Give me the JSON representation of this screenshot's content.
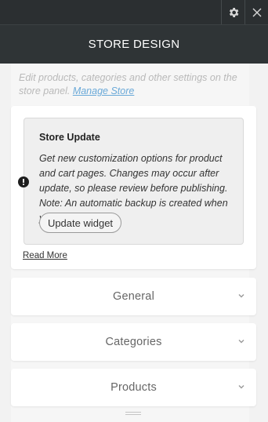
{
  "topbar": {
    "settings_icon": "gear-icon",
    "close_icon": "close-icon"
  },
  "header": {
    "title": "STORE DESIGN"
  },
  "description": {
    "text": "Edit products, categories and other settings on the store panel.",
    "link": "Manage Store"
  },
  "notice": {
    "title": "Store Update",
    "body": "Get new customization options for product and cart pages. Changes may occur after update, so please review before publishing. Note: An automatic backup is created when you update.",
    "button": "Update widget",
    "read_more": "Read More",
    "icon": "alert-icon"
  },
  "sections": [
    {
      "label": "General"
    },
    {
      "label": "Categories"
    },
    {
      "label": "Products"
    }
  ],
  "colors": {
    "header_bg": "#2f3436",
    "link": "#6aa9d8"
  }
}
